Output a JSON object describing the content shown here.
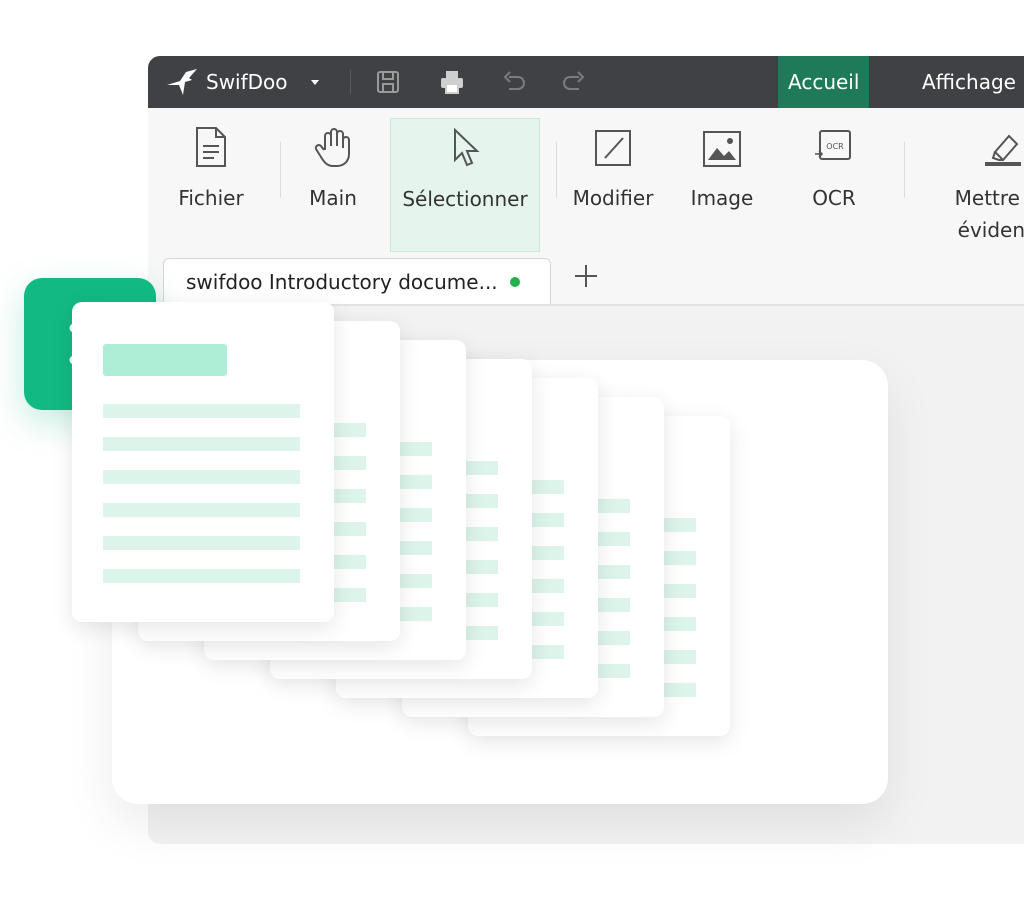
{
  "app": {
    "name": "SwifDoo",
    "menu_tabs": [
      {
        "label": "Accueil",
        "active": true
      },
      {
        "label": "Affichage",
        "active": false
      }
    ],
    "quick_icons": [
      "save-icon",
      "print-icon",
      "undo-icon",
      "redo-icon"
    ]
  },
  "ribbon": {
    "items": [
      {
        "label": "Fichier",
        "icon": "file-icon"
      },
      {
        "label": "Main",
        "icon": "hand-icon"
      },
      {
        "label": "Sélectionner",
        "icon": "cursor-icon",
        "selected": true
      },
      {
        "label": "Modifier",
        "icon": "edit-icon"
      },
      {
        "label": "Image",
        "icon": "image-icon"
      },
      {
        "label": "OCR",
        "icon": "ocr-icon",
        "icon_text": "OCR"
      },
      {
        "label": "Mettre en évidence",
        "icon": "highlight-icon"
      }
    ]
  },
  "document_tabs": [
    {
      "title": "swifdoo Introductory docume...",
      "status_color": "#22b14c"
    }
  ],
  "colors": {
    "titlebar": "#3f4145",
    "accent": "#13b983",
    "active_tab": "#1f7a5a",
    "doc_lines": "#dcf4ea"
  },
  "overlay": {
    "badge_icon": "convert-arrows-icon"
  }
}
